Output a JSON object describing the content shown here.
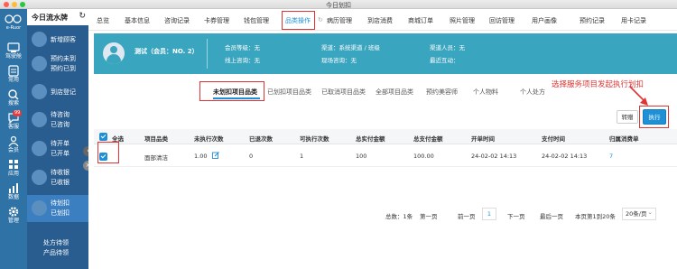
{
  "window": {
    "title": "今日划扣"
  },
  "sidebar": {
    "logo_text": "e-Ruor",
    "items": [
      {
        "label": "驾驶舱",
        "icon": "dashboard-icon"
      },
      {
        "label": "常用",
        "icon": "grid-icon"
      },
      {
        "label": "搜索",
        "icon": "search-icon"
      },
      {
        "label": "客服",
        "icon": "chat-icon",
        "badge": "99"
      },
      {
        "label": "会员",
        "icon": "member-icon"
      },
      {
        "label": "应用",
        "icon": "apps-icon"
      },
      {
        "label": "数据",
        "icon": "chart-icon"
      },
      {
        "label": "管理",
        "icon": "gear-icon"
      }
    ]
  },
  "subpanel": {
    "title": "今日流水牌",
    "items": [
      {
        "lines": [
          "新增顾客"
        ]
      },
      {
        "lines": [
          "预约未到",
          "预约已到"
        ]
      },
      {
        "lines": [
          "到店登记"
        ]
      },
      {
        "lines": [
          "待咨询",
          "已咨询"
        ]
      },
      {
        "lines": [
          "待开单",
          "已开单"
        ]
      },
      {
        "lines": [
          "待收银",
          "已收银"
        ]
      },
      {
        "lines": [
          "待划扣",
          "已划扣"
        ]
      },
      {
        "lines": [
          "处方待领",
          "产品待领"
        ]
      }
    ]
  },
  "nav": {
    "tabs": [
      "总览",
      "基本信息",
      "咨询记录",
      "卡券管理",
      "钱包管理",
      "品类操作",
      "病历管理",
      "到店消费",
      "商城订单",
      "照片管理",
      "回访管理",
      "用户画像",
      "预约记录",
      "用卡记录"
    ],
    "active_index": 5
  },
  "member": {
    "name": "测试（会员：NO. 2）",
    "fields": [
      {
        "label": "会员等级：",
        "value": "无"
      },
      {
        "label": "线上咨询：",
        "value": "无"
      },
      {
        "label": "渠道：",
        "value": "系统渠道 / 班级"
      },
      {
        "label": "现场咨询：",
        "value": "无"
      },
      {
        "label": "渠道人员：",
        "value": "无"
      },
      {
        "label": "最近互动：",
        "value": ""
      }
    ]
  },
  "subtabs": {
    "items": [
      "未划扣项目品类",
      "已划扣项目品类",
      "已取消项目品类",
      "全部项目品类",
      "预约美容师",
      "个人物料",
      "个人处方"
    ],
    "active_index": 0
  },
  "annotation": "选择服务项目发起执行划扣",
  "buttons": {
    "transfer": "转赠",
    "execute": "执行"
  },
  "table": {
    "select_all_label": "全选",
    "columns": [
      "项目品类",
      "未执行次数",
      "已退次数",
      "可执行次数",
      "总实付金额",
      "总支付金额",
      "开单时间",
      "支付时间",
      "归属消费单"
    ],
    "rows": [
      [
        "面部清洁",
        "1.00",
        "0",
        "1",
        "100",
        "100.00",
        "24-02-02 14:13",
        "24-02-02 14:13",
        "7"
      ]
    ]
  },
  "pagination": {
    "total": "总数：1条",
    "first": "第一页",
    "prev": "前一页",
    "page": "1",
    "next": "下一页",
    "last": "最后一页",
    "summary": "本页第1到20条",
    "page_size": "20条/页"
  },
  "colors": {
    "accent": "#1e90d6",
    "banner": "#3aa5bf",
    "sidebar": "#2f72a5",
    "highlight": "#e03333"
  }
}
